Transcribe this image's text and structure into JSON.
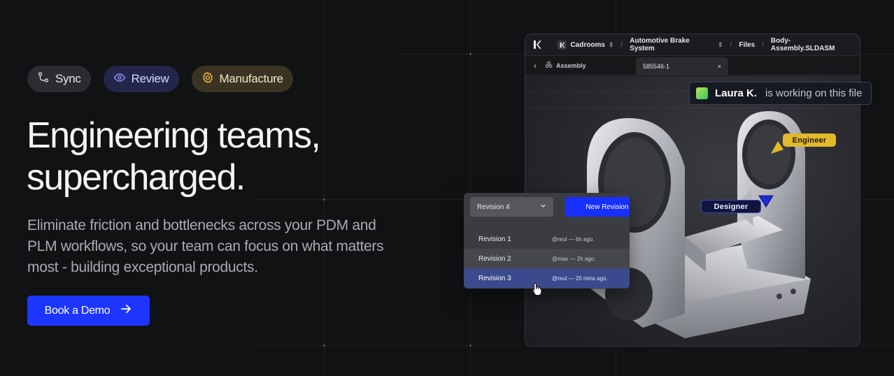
{
  "hero": {
    "pills": [
      {
        "label": "Sync",
        "icon": "branch-icon"
      },
      {
        "label": "Review",
        "icon": "eye-icon"
      },
      {
        "label": "Manufacture",
        "icon": "gear-icon"
      }
    ],
    "headline_line1": "Engineering teams,",
    "headline_line2": "supercharged.",
    "subcopy": "Eliminate friction and bottlenecks across your PDM and PLM workflows, so your team can focus on what matters most - building exceptional products.",
    "cta_label": "Book a Demo"
  },
  "app": {
    "breadcrumb": {
      "workspace": "Cadrooms",
      "project": "Automotive Brake System",
      "section": "Files",
      "file": "Body-Assembly.SLDASM"
    },
    "tabs": {
      "assembly_label": "Assembly",
      "file_tab": "585546-1",
      "close_glyph": "×"
    },
    "presence": {
      "name": "Laura K.",
      "text": "is working on this file"
    },
    "tags": {
      "engineer": "Engineer",
      "designer": "Designer"
    },
    "revisions": {
      "selected": "Revision 4",
      "new_label": "New Revision",
      "items": [
        {
          "name": "Revision 1",
          "meta": "@reul — 6h ago."
        },
        {
          "name": "Revision 2",
          "meta": "@max — 2h ago."
        },
        {
          "name": "Revision 3",
          "meta": "@reul — 20 mins ago."
        }
      ]
    },
    "toolbar": [
      "rotate-icon",
      "orbit-icon",
      "cube-icon",
      "grid-icon",
      "camera-icon",
      "box-icon",
      "section-icon",
      "comment-icon"
    ]
  },
  "colors": {
    "accent": "#1c36ff",
    "engineer_tag": "#e3b92c",
    "designer_tag": "#10153f",
    "background": "#111214"
  }
}
